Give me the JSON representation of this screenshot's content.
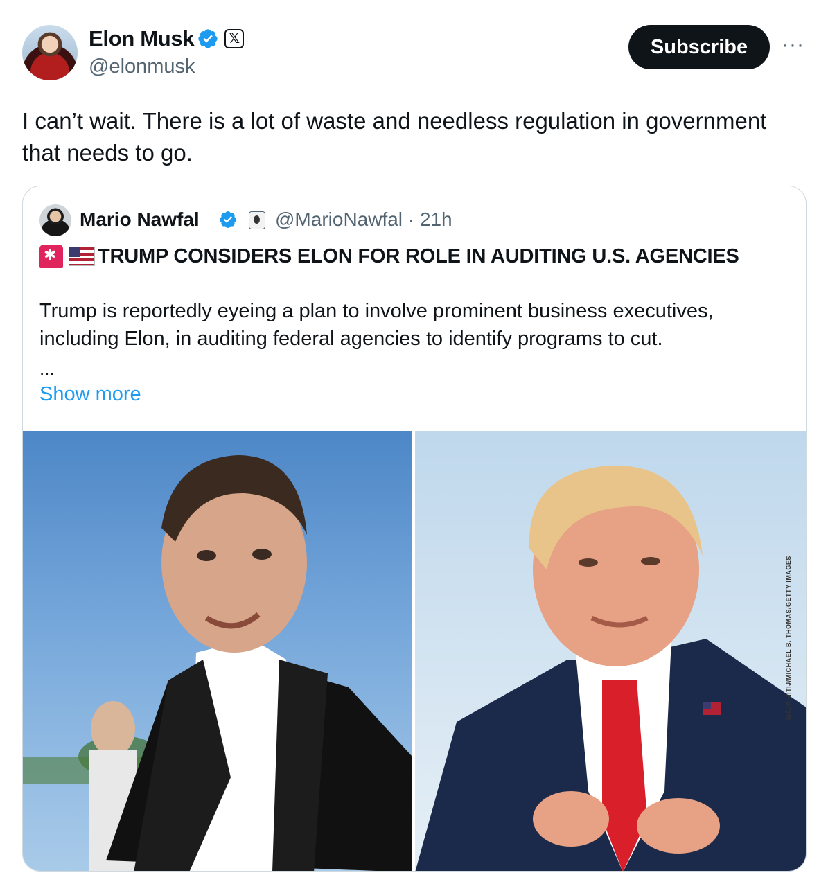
{
  "post": {
    "author": {
      "name": "Elon Musk",
      "handle": "@elonmusk"
    },
    "subscribe_label": "Subscribe",
    "more_label": "···",
    "text": "I can’t wait. There is a lot of waste and needless regulation in government that needs to go."
  },
  "quote": {
    "author": {
      "name": "Mario Nawfal",
      "handle": "@MarioNawfal",
      "time": "21h"
    },
    "meta_line": "@MarioNawfal · 21h",
    "headline": "TRUMP CONSIDERS ELON FOR ROLE IN AUDITING U.S. AGENCIES",
    "body": "Trump is reportedly eyeing a plan to involve prominent business executives, including Elon, in auditing federal agencies to identify programs to cut.",
    "ellipsis": "...",
    "show_more": "Show more",
    "photo_credit": "MAJA HITIJ/MICHAEL B. THOMAS/GETTY IMAGES"
  },
  "colors": {
    "text": "#0f1419",
    "secondary": "#536471",
    "link": "#1d9bf0",
    "border": "#cfd9de",
    "verified": "#1d9bf0"
  },
  "icons": [
    "verified-badge-icon",
    "x-affiliate-icon",
    "more-icon",
    "siren-emoji-icon",
    "us-flag-emoji-icon"
  ]
}
